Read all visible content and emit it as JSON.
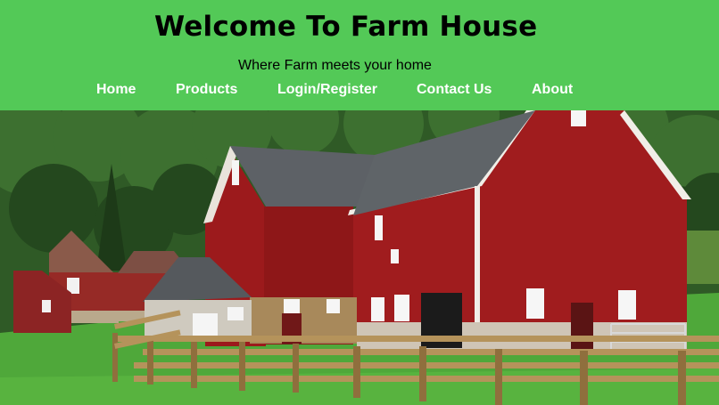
{
  "site": {
    "title": "Welcome To Farm House",
    "tagline": "Where Farm meets your home"
  },
  "nav": {
    "items": [
      {
        "label": "Home"
      },
      {
        "label": "Products"
      },
      {
        "label": "Login/Register"
      },
      {
        "label": "Contact Us"
      },
      {
        "label": "About"
      }
    ]
  },
  "hero": {
    "image": "farm-barn-photo"
  },
  "colors": {
    "header_bg": "#53c957",
    "title_text": "#000000",
    "nav_text": "#ffffff",
    "barn_red": "#9c1a1c",
    "roof_gray": "#5d6166",
    "grass_green": "#4fa83a"
  }
}
